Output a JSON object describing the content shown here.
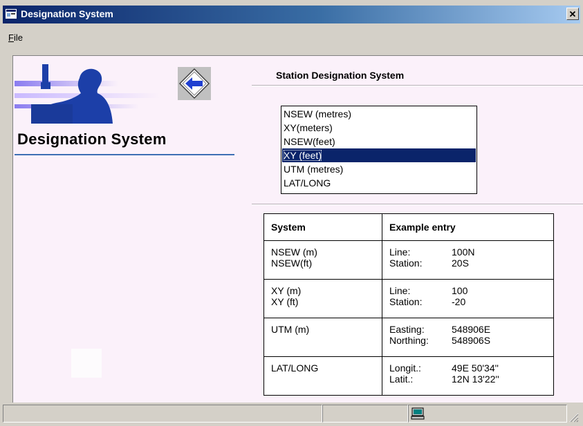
{
  "window": {
    "title": "Designation System",
    "close_label": "✕"
  },
  "menu": {
    "file_accel": "F",
    "file_rest": "ile"
  },
  "logo": {
    "title": "Designation System"
  },
  "heading": "Station Designation System",
  "systems": {
    "items": [
      "NSEW (metres)",
      "XY(meters)",
      "NSEW(feet)",
      "XY (feet)",
      "UTM (metres)",
      "LAT/LONG"
    ],
    "selected_index": 3
  },
  "table": {
    "headers": [
      "System",
      "Example entry"
    ],
    "rows": [
      {
        "systems": [
          "NSEW (m)",
          "NSEW(ft)"
        ],
        "entries": [
          [
            "Line:",
            "100N"
          ],
          [
            "Station:",
            "20S"
          ]
        ]
      },
      {
        "systems": [
          "XY (m)",
          "XY (ft)"
        ],
        "entries": [
          [
            "Line:",
            "100"
          ],
          [
            "Station:",
            "-20"
          ]
        ]
      },
      {
        "systems": [
          "UTM (m)"
        ],
        "entries": [
          [
            "Easting:",
            "548906E"
          ],
          [
            "Northing:",
            "548906S"
          ]
        ]
      },
      {
        "systems": [
          "LAT/LONG"
        ],
        "entries": [
          [
            "Longit.:",
            "49E 50'34''"
          ],
          [
            "Latit.:",
            "12N 13'22''"
          ]
        ]
      }
    ]
  },
  "colors": {
    "titlebar_start": "#0a246a",
    "titlebar_end": "#a6caf0",
    "client_bg": "#fbf1fa",
    "accent_rule": "#3d6fb4",
    "selection": "#0a246a"
  },
  "icons": {
    "title": "app-window-icon",
    "back": "back-arrow-icon",
    "status": "computer-monitor-icon",
    "grip": "resize-grip-icon"
  }
}
